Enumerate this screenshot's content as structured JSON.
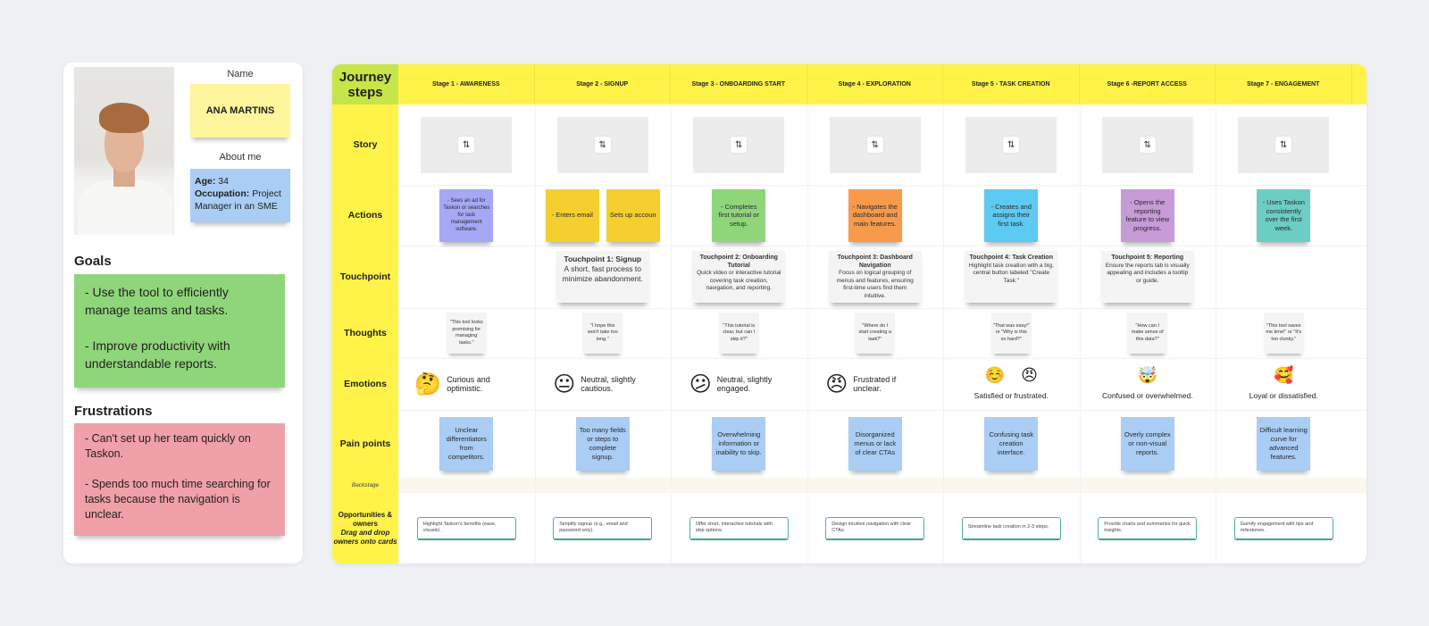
{
  "persona": {
    "photo_alt": "Portrait of Ana Martins",
    "name_label": "Name",
    "name": "ANA MARTINS",
    "about_label": "About me",
    "age_label": "Age:",
    "age": "34",
    "occupation_label": "Occupation:",
    "occupation": "Project Manager in an SME",
    "goals_title": "Goals",
    "goals": "- Use the tool to efficiently manage teams and tasks.\n\n- Improve productivity with understandable reports.",
    "frustrations_title": "Frustrations",
    "frustrations": "- Can't set up her team quickly on Taskon.\n\n- Spends too much time searching for tasks because the navigation is unclear."
  },
  "journey": {
    "corner_title": "Journey steps",
    "row_labels": {
      "story": "Story",
      "actions": "Actions",
      "touchpoint": "Touchpoint",
      "thoughts": "Thoughts",
      "emotions": "Emotions",
      "pain_points": "Pain points",
      "backstage": "Backstage",
      "opportunities": "Opportunities & owners",
      "opportunities_sub": "Drag and drop owners onto cards"
    },
    "story_icon": "swap-icon",
    "stages": [
      {
        "title": "Stage 1 -  AWARENESS",
        "actions": [
          {
            "text": "- Sees an ad for Taskon or searches for task management software.",
            "color": "#a5a8f5"
          }
        ],
        "touchpoint": null,
        "thought": "\"This tool looks promising for managing tasks.\"",
        "emotion": {
          "emojis": [
            "🤔"
          ],
          "text": "Curious and optimistic."
        },
        "pain": "Unclear differentiators from competitors.",
        "opportunity": "Highlight Taskon's benefits (ease, visuals)."
      },
      {
        "title": "Stage 2 -  SIGNUP",
        "actions": [
          {
            "text": "- Enters email",
            "color": "#f5cf2f"
          },
          {
            "text": "Sets up accoun",
            "color": "#f5cf2f"
          }
        ],
        "touchpoint": {
          "title": "Touchpoint 1: Signup",
          "body": "A short, fast process to minimize abandonment."
        },
        "thought": "\"I hope this won't take too long.\"",
        "emotion": {
          "emojis": [
            "😐"
          ],
          "text": "Neutral, slightly cautious."
        },
        "pain": "Too many fields or steps to complete signup.",
        "opportunity": "Simplify signup (e.g., email and password only)."
      },
      {
        "title": "Stage 3 - ONBOARDING START",
        "actions": [
          {
            "text": "- Completes first tutorial or setup.",
            "color": "#8fd67a"
          }
        ],
        "touchpoint": {
          "title": "Touchpoint 2: Onboarding Tutorial",
          "body": "Quick video or interactive tutorial covering task creation, navigation, and reporting."
        },
        "thought": "\"This tutorial is clear, but can I skip it?\"",
        "emotion": {
          "emojis": [
            "😕"
          ],
          "text": "Neutral, slightly engaged."
        },
        "pain": "Overwhelming information or inability to skip.",
        "opportunity": "Offer short, interactive tutorials with skip options."
      },
      {
        "title": "Stage 4 - EXPLORATION",
        "actions": [
          {
            "text": "- Navigates the dashboard and main features.",
            "color": "#f79a4b"
          }
        ],
        "touchpoint": {
          "title": "Touchpoint 3: Dashboard Navigation",
          "body": "Focus on logical grouping of menus and features, ensuring first-time users find them intuitive."
        },
        "thought": "\"Where do I start creating a task?\"",
        "emotion": {
          "emojis": [
            "😠"
          ],
          "text": "Frustrated if unclear."
        },
        "pain": "Disorganized menus or lack of clear CTAs",
        "opportunity": "Design intuitive navigation with clear CTAs."
      },
      {
        "title": "Stage 5 - TASK CREATION",
        "actions": [
          {
            "text": "- Creates and assigns their first task.",
            "color": "#5ccaf2"
          }
        ],
        "touchpoint": {
          "title": "Touchpoint 4: Task Creation",
          "body": "Highlight task creation with a big, central button labeled \"Create Task.\""
        },
        "thought": "\"That was easy!\" or \"Why is this so hard?\"",
        "emotion": {
          "emojis": [
            "☺️",
            "😠"
          ],
          "text": "Satisfied or frustrated."
        },
        "pain": "Confusing task creation interface.",
        "opportunity": "Streamline task creation in 2-3 steps."
      },
      {
        "title": "Stage 6 -REPORT ACCESS",
        "actions": [
          {
            "text": "- Opens the reporting feature to view progress.",
            "color": "#c79ad8"
          }
        ],
        "touchpoint": {
          "title": "Touchpoint 5: Reporting",
          "body": "Ensure the reports tab is visually appealing and includes a tooltip or guide."
        },
        "thought": "\"How can I make sense of this data?\"",
        "emotion": {
          "emojis": [
            "🤯"
          ],
          "text": "Confused or overwhelmed."
        },
        "pain": "Overly complex or non-visual reports.",
        "opportunity": "Provide charts and summaries for quick insights."
      },
      {
        "title": "Stage 7 - ENGAGEMENT",
        "actions": [
          {
            "text": "- Uses Taskon consistently over the first week.",
            "color": "#6ccdc5"
          }
        ],
        "touchpoint": null,
        "thought": "\"This tool saves me time!\" or \"It's too clunky.\"",
        "emotion": {
          "emojis": [
            "🥰"
          ],
          "text": "Loyal or dissatisfied."
        },
        "pain": "Difficult learning curve for advanced features.",
        "opportunity": "Gamify engagement with tips and milestones."
      }
    ]
  },
  "colors": {
    "board_yellow": "#fff349",
    "corner_green": "#c6e548",
    "name_note": "#fff59d",
    "about_note": "#a9cdf5",
    "goals_note": "#8fd67a",
    "frustrations_note": "#f0a0a8",
    "pain_note": "#a9cdf5",
    "opportunity_border": "#4bb39a"
  }
}
